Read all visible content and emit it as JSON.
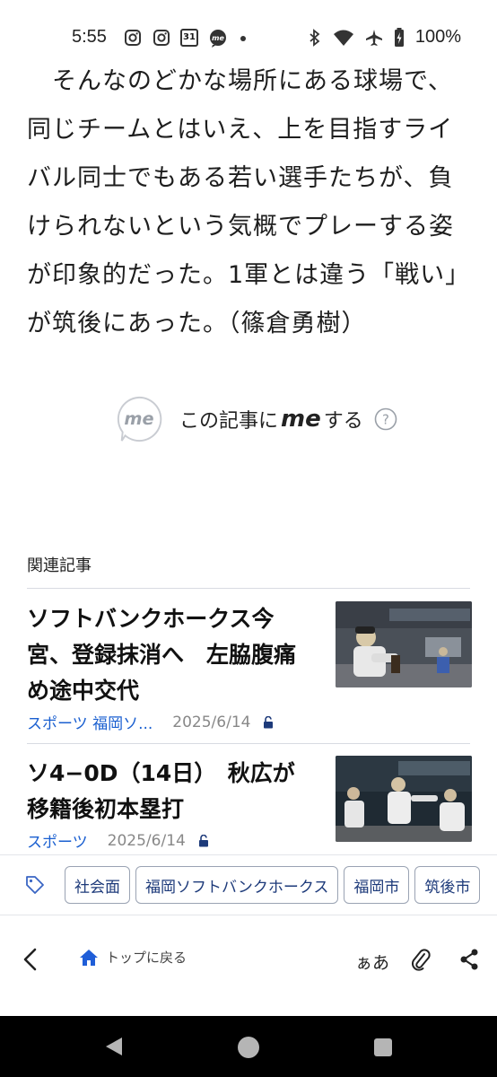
{
  "status_bar": {
    "time": "5:55",
    "notification_icons": [
      "instagram-icon",
      "instagram-icon",
      "calendar-icon",
      "me-app-icon",
      "dot-icon"
    ],
    "calendar_day": "31",
    "battery": "100%"
  },
  "article": {
    "paragraph_lines": [
      "　そんなのどかな場所にある球場で、",
      "同じチームとはいえ、上を目指すライ",
      "バル同士でもある若い選手たちが、負",
      "けられないという気概でプレーする姿",
      "が印象的だった。1軍とは違う「戦い」",
      "が筑後にあった。（篠倉勇樹）"
    ]
  },
  "me_action": {
    "badge": "me",
    "prefix": "この記事に",
    "word": "me",
    "suffix": "する",
    "help": "?"
  },
  "related": {
    "heading": "関連記事",
    "items": [
      {
        "title_lines": [
          "ソフトバンクホークス今",
          "宮、登録抹消へ　左脇腹痛",
          "め途中交代"
        ],
        "categories": "スポーツ  福岡ソ...",
        "date": "2025/6/14"
      },
      {
        "title_lines": [
          "ソ4−0D（14日）　秋広が",
          "移籍後初本塁打"
        ],
        "categories": "スポーツ",
        "date": "2025/6/14"
      }
    ]
  },
  "tags": [
    "社会面",
    "福岡ソフトバンクホークス",
    "福岡市",
    "筑後市"
  ],
  "toolbar": {
    "home_label": "トップに戻る",
    "font_size_label": "ぁあ"
  },
  "colors": {
    "accent_blue": "#1a5fd0",
    "tag_text": "#1d3a7a",
    "home_icon": "#1f5ed8"
  }
}
